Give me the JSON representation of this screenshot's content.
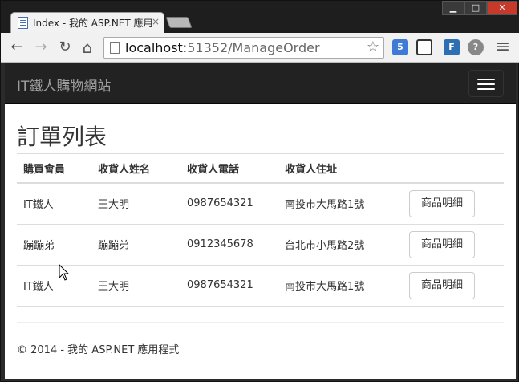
{
  "browser": {
    "tab_title": "Index - 我的 ASP.NET 應用",
    "tab_close": "×",
    "url_host": "localhost",
    "url_path": ":51352/ManageOrder",
    "star": "☆",
    "win_min": "▁",
    "win_max": "□",
    "win_close": "✕",
    "back": "←",
    "forward": "→",
    "reload": "↻",
    "home": "⌂",
    "menu": "≡",
    "ext_labels": [
      "5",
      "",
      "F",
      "?"
    ]
  },
  "navbar": {
    "brand": "IT鐵人購物網站"
  },
  "page": {
    "title": "訂單列表",
    "table": {
      "headers": [
        "購買會員",
        "收貨人姓名",
        "收貨人電話",
        "收貨人住址",
        ""
      ],
      "rows": [
        {
          "member": "IT鐵人",
          "name": "王大明",
          "phone": "0987654321",
          "address": "南投市大馬路1號",
          "button": "商品明細"
        },
        {
          "member": "蹦蹦弟",
          "name": "蹦蹦弟",
          "phone": "0912345678",
          "address": "台北市小馬路2號",
          "button": "商品明細"
        },
        {
          "member": "IT鐵人",
          "name": "王大明",
          "phone": "0987654321",
          "address": "南投市大馬路1號",
          "button": "商品明細"
        }
      ]
    },
    "footer": "© 2014 - 我的 ASP.NET 應用程式"
  }
}
